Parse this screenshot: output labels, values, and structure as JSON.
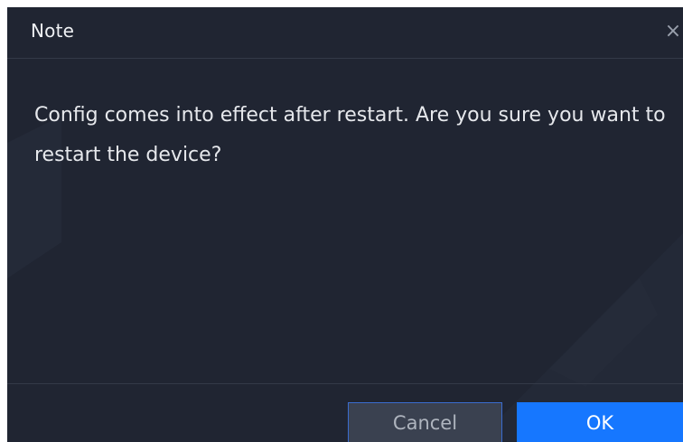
{
  "dialog": {
    "title": "Note",
    "close_icon": "close-icon",
    "close_glyph": "×",
    "message": "Config comes into effect after restart. Are you sure you want to restart the device?",
    "buttons": {
      "cancel_label": "Cancel",
      "ok_label": "OK"
    }
  },
  "colors": {
    "background": "#202532",
    "accent": "#1677ff",
    "cancel_border": "#3a6ccf",
    "text": "#e6e8ec"
  }
}
